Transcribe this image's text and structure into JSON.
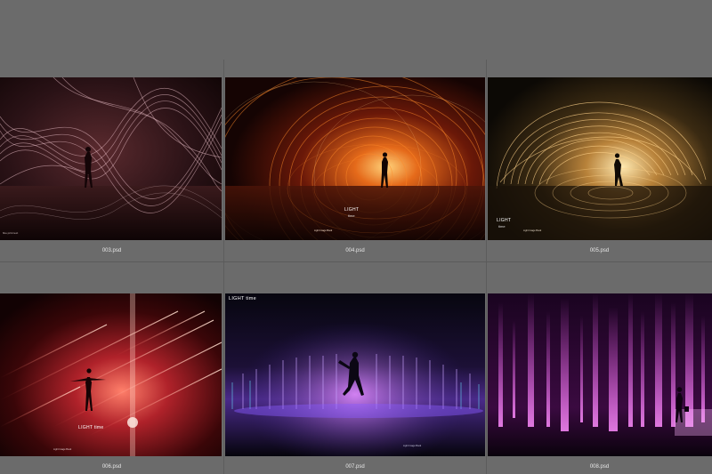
{
  "browser": {
    "thumbnails": [
      {
        "filename": "003.psd",
        "overlay_title": "",
        "overlay_sub": ""
      },
      {
        "filename": "004.psd",
        "overlay_title": "LIGHT",
        "overlay_sub": "time"
      },
      {
        "filename": "005.psd",
        "overlay_title": "LIGHT",
        "overlay_sub": "time"
      },
      {
        "filename": "006.psd",
        "overlay_title": "LIGHT time",
        "overlay_sub": ""
      },
      {
        "filename": "007.psd",
        "overlay_title": "LIGHT time",
        "overlay_sub": ""
      },
      {
        "filename": "008.psd",
        "overlay_title": "",
        "overlay_sub": ""
      }
    ]
  }
}
